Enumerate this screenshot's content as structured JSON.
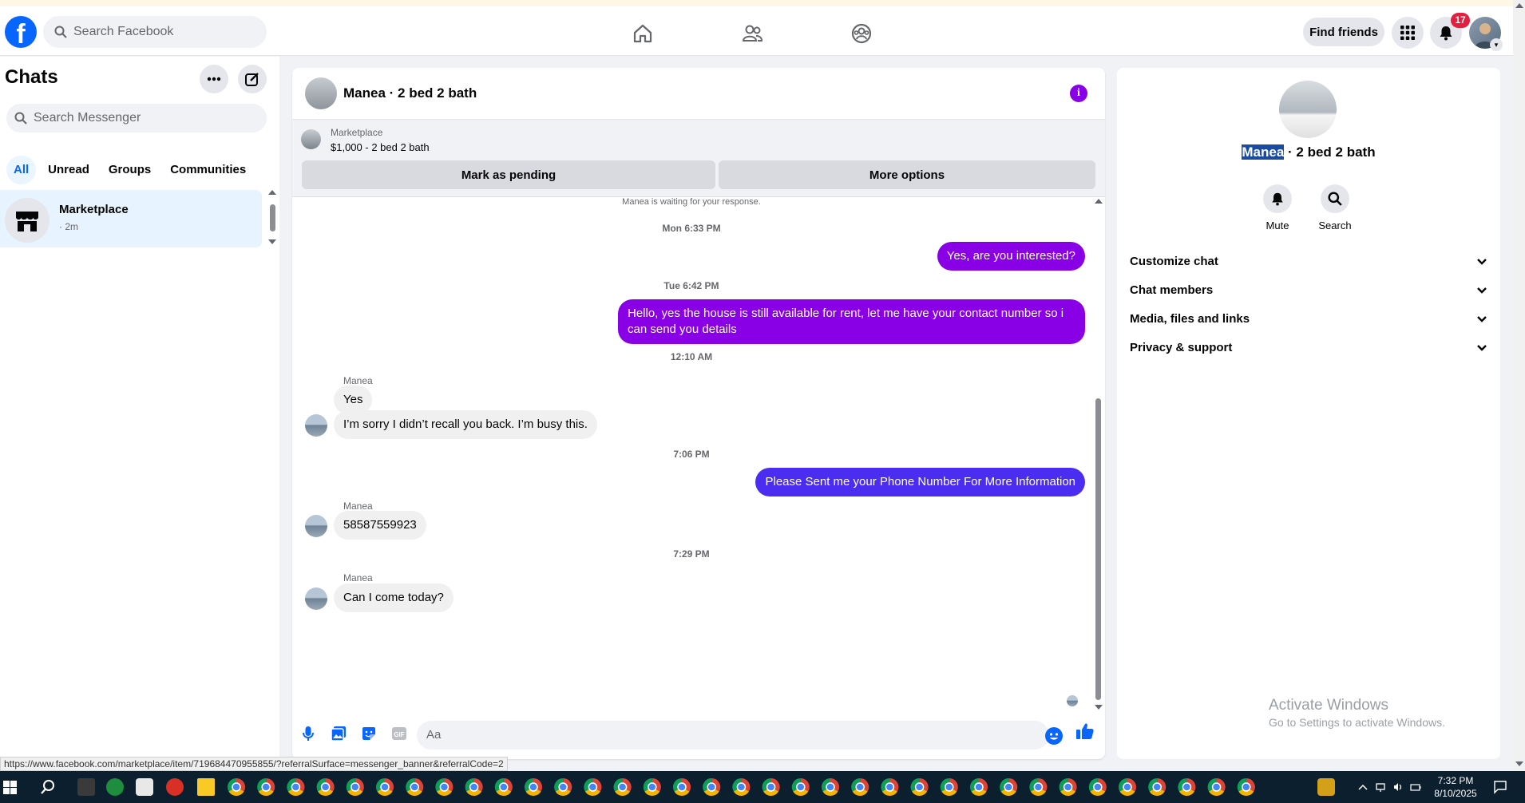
{
  "header": {
    "logo": "f",
    "search_placeholder": "Search Facebook",
    "nav_icons": [
      "home-icon",
      "friends-icon",
      "groups-icon"
    ],
    "find_friends_label": "Find friends",
    "notification_count": "17"
  },
  "sidebar": {
    "title": "Chats",
    "search_placeholder": "Search Messenger",
    "filters": [
      "All",
      "Unread",
      "Groups",
      "Communities"
    ],
    "active_filter": "All",
    "chats": [
      {
        "name": "Marketplace",
        "time": "· 2m"
      }
    ]
  },
  "conversation": {
    "title": "Manea · 2 bed 2 bath",
    "marketplace": {
      "label": "Marketplace",
      "listing": "$1,000 - 2 bed 2 bath",
      "pending_label": "Mark as pending",
      "more_label": "More options"
    },
    "waiting_note": "Manea is waiting for your response.",
    "timestamps": [
      "Mon 6:33 PM",
      "Tue 6:42 PM",
      "12:10 AM",
      "7:06 PM",
      "7:29 PM"
    ],
    "messages": [
      {
        "text": "Yes, are you interested?",
        "direction": "out",
        "color": "#8a00e6"
      },
      {
        "text": "Hello, yes the house is still available for rent, let me have your contact number so i can send you details",
        "direction": "out",
        "color": "#8a00e6"
      },
      {
        "sender": "Manea",
        "text": "Yes",
        "direction": "in"
      },
      {
        "text": "I’m sorry I didn’t recall you back. I’m busy this.",
        "direction": "in"
      },
      {
        "text": "Please Sent me your Phone Number For More Information",
        "direction": "out",
        "color": "#4a2df0"
      },
      {
        "sender": "Manea",
        "text": "58587559923",
        "direction": "in"
      },
      {
        "sender": "Manea",
        "text": "Can I come today?",
        "direction": "in"
      }
    ],
    "composer_placeholder": "Aa"
  },
  "info_panel": {
    "name_highlight": "Manea",
    "name_rest": " · 2 bed 2 bath",
    "actions": [
      {
        "label": "Mute",
        "icon": "bell-icon"
      },
      {
        "label": "Search",
        "icon": "search-icon"
      }
    ],
    "sections": [
      "Customize chat",
      "Chat members",
      "Media, files and links",
      "Privacy & support"
    ]
  },
  "watermark": {
    "line1": "Activate Windows",
    "line2": "Go to Settings to activate Windows."
  },
  "status_url": "https://www.facebook.com/marketplace/item/719684470955855/?referralSurface=messenger_banner&referralCode=2",
  "taskbar": {
    "time": "7:32 PM",
    "date": "8/10/2025"
  },
  "colors": {
    "facebook_blue": "#0866ff",
    "messenger_purple": "#8a00e6",
    "notification_red": "#e41e3f"
  }
}
